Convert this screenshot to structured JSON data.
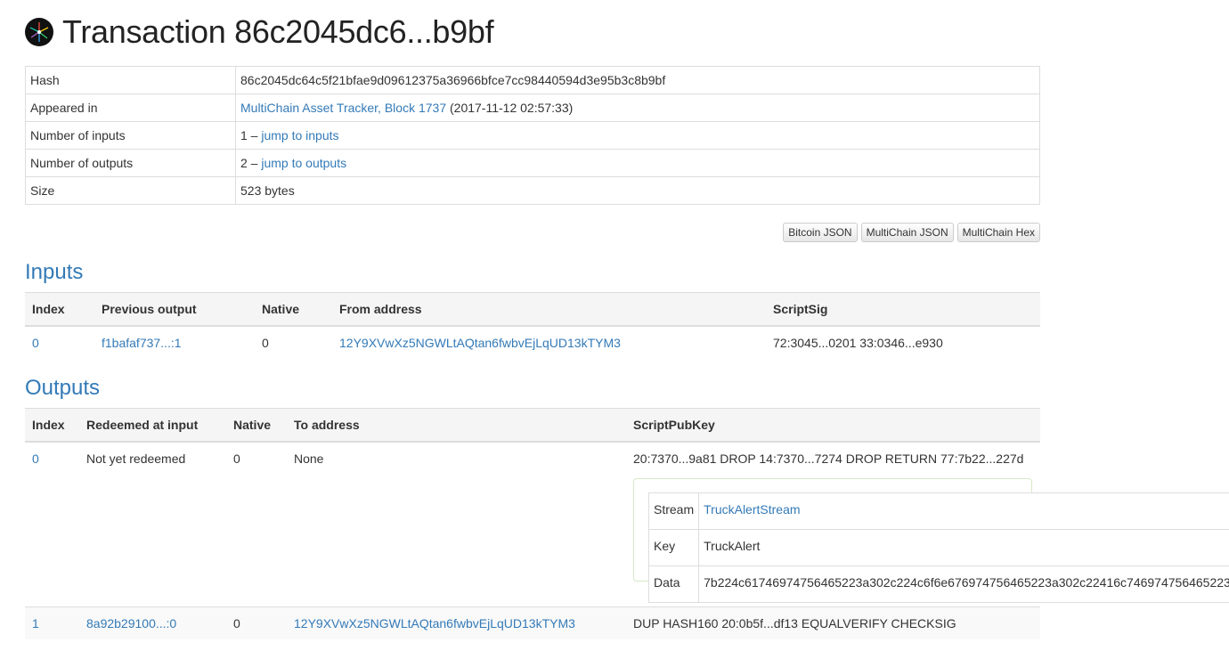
{
  "header": {
    "title": "Transaction 86c2045dc6...b9bf",
    "logo_icon": "multichain-logo-icon"
  },
  "summary": {
    "hash_label": "Hash",
    "hash_value": "86c2045dc64c5f21bfae9d09612375a36966bfce7cc98440594d3e95b3c8b9bf",
    "appeared_label": "Appeared in",
    "appeared_link": "MultiChain Asset Tracker, Block 1737",
    "appeared_time": "(2017-11-12 02:57:33)",
    "inputs_label": "Number of inputs",
    "inputs_count": "1 –",
    "inputs_link": "jump to inputs",
    "outputs_label": "Number of outputs",
    "outputs_count": "2 –",
    "outputs_link": "jump to outputs",
    "size_label": "Size",
    "size_value": "523 bytes"
  },
  "buttons": {
    "bitcoin_json": "Bitcoin JSON",
    "multichain_json": "MultiChain JSON",
    "multichain_hex": "MultiChain Hex"
  },
  "inputs": {
    "heading": "Inputs",
    "headers": {
      "index": "Index",
      "prev": "Previous output",
      "native": "Native",
      "from": "From address",
      "script": "ScriptSig"
    },
    "rows": [
      {
        "index": "0",
        "prev": "f1bafaf737...:1",
        "native": "0",
        "from": "12Y9XVwXz5NGWLtAQtan6fwbvEjLqUD13kTYM3",
        "script": "72:3045...0201 33:0346...e930"
      }
    ]
  },
  "outputs": {
    "heading": "Outputs",
    "headers": {
      "index": "Index",
      "redeemed": "Redeemed at input",
      "native": "Native",
      "to": "To address",
      "script": "ScriptPubKey"
    },
    "rows": [
      {
        "index": "0",
        "redeemed": "Not yet redeemed",
        "native": "0",
        "to": "None",
        "script": "20:7370...9a81 DROP 14:7370...7274 DROP RETURN 77:7b22...227d",
        "stream": {
          "stream_label": "Stream",
          "stream_value": "TruckAlertStream",
          "key_label": "Key",
          "key_value": "TruckAlert",
          "data_label": "Data",
          "data_value": "7b224c61746974756465223a302c224c6f6e676974756465223a302c22416c746974756465223"
        }
      },
      {
        "index": "1",
        "redeemed": "8a92b29100...:0",
        "native": "0",
        "to": "12Y9XVwXz5NGWLtAQtan6fwbvEjLqUD13kTYM3",
        "script": "DUP HASH160 20:0b5f...df13 EQUALVERIFY CHECKSIG"
      }
    ]
  }
}
